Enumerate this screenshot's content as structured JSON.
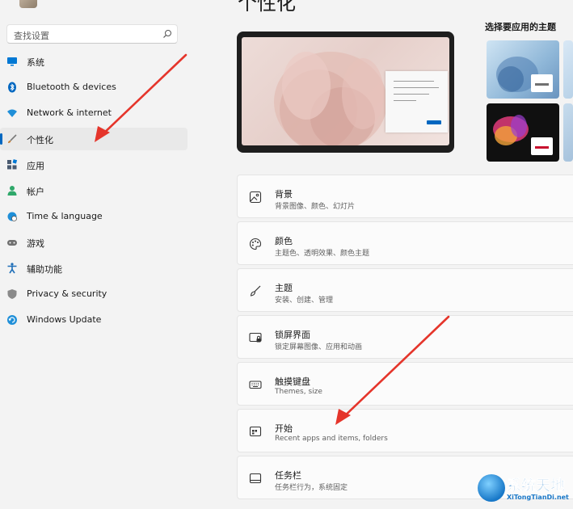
{
  "page": {
    "title": "个性化"
  },
  "search": {
    "placeholder": "查找设置"
  },
  "sidebar": {
    "items": [
      {
        "label": "系统",
        "icon": "display-icon",
        "color": "#0078d4"
      },
      {
        "label": "Bluetooth & devices",
        "icon": "bluetooth-icon",
        "color": "#0067c0"
      },
      {
        "label": "Network & internet",
        "icon": "wifi-icon",
        "color": "#1f8fd8"
      },
      {
        "label": "个性化",
        "icon": "brush-icon",
        "color": "#c47a2c",
        "active": true
      },
      {
        "label": "应用",
        "icon": "apps-icon",
        "color": "#4a5a70"
      },
      {
        "label": "帐户",
        "icon": "person-icon",
        "color": "#2fa86a"
      },
      {
        "label": "Time & language",
        "icon": "globe-clock-icon",
        "color": "#1f8fd8"
      },
      {
        "label": "游戏",
        "icon": "gamepad-icon",
        "color": "#707070"
      },
      {
        "label": "辅助功能",
        "icon": "accessibility-icon",
        "color": "#1f6fb8"
      },
      {
        "label": "Privacy & security",
        "icon": "shield-icon",
        "color": "#8a8a8a"
      },
      {
        "label": "Windows Update",
        "icon": "update-icon",
        "color": "#1f8fd8"
      }
    ]
  },
  "themes": {
    "label": "选择要应用的主题"
  },
  "settings": [
    {
      "title": "背景",
      "subtitle": "背景图像、颜色、幻灯片",
      "icon": "image-icon"
    },
    {
      "title": "颜色",
      "subtitle": "主题色、透明效果、颜色主题",
      "icon": "palette-icon"
    },
    {
      "title": "主题",
      "subtitle": "安装、创建、管理",
      "icon": "brush-icon"
    },
    {
      "title": "锁屏界面",
      "subtitle": "锁定屏幕图像、应用和动画",
      "icon": "lock-screen-icon"
    },
    {
      "title": "触摸键盘",
      "subtitle": "Themes, size",
      "icon": "keyboard-icon"
    },
    {
      "title": "开始",
      "subtitle": "Recent apps and items, folders",
      "icon": "start-icon"
    },
    {
      "title": "任务栏",
      "subtitle": "任务栏行为，系统固定",
      "icon": "taskbar-icon"
    }
  ],
  "watermark": {
    "title": "系统天地",
    "url": "XiTongTianDi.net"
  },
  "colors": {
    "accent": "#0067c0",
    "annotation_arrow": "#e5352b"
  }
}
